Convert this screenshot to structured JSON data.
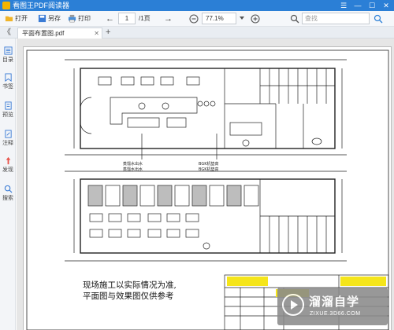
{
  "titlebar": {
    "app_title": "看图王PDF阅读器",
    "controls": [
      "☰",
      "—",
      "☐",
      "✕"
    ]
  },
  "toolbar": {
    "open_label": "打开",
    "saveas_label": "另存",
    "print_label": "打印",
    "prev_icon": "←",
    "page_current": "1",
    "page_total": "/1页",
    "next_icon": "→",
    "zoom_value": "77.1%",
    "search_placeholder": "查找"
  },
  "tabs": {
    "collapse_icon": "《",
    "items": [
      {
        "label": "平面布置图.pdf"
      }
    ],
    "add_icon": "+"
  },
  "sidebar": {
    "items": [
      {
        "label": "目录",
        "icon": "list-icon"
      },
      {
        "label": "书签",
        "icon": "bookmark-icon"
      },
      {
        "label": "预览",
        "icon": "preview-icon"
      },
      {
        "label": "注释",
        "icon": "note-icon"
      },
      {
        "label": "发现",
        "icon": "discover-icon"
      },
      {
        "label": "搜索",
        "icon": "search-icon"
      }
    ]
  },
  "drawing": {
    "upper_labels": [
      "蒸馏水出水",
      "BGK机垫高",
      "蒸馏水出水",
      "BGK机垫高"
    ],
    "note_lines": [
      "现场施工以实际情况为准,",
      "平面图与效果图仅供参考"
    ]
  },
  "watermark": {
    "brand": "溜溜自学",
    "url": "ZIXUE.3D66.COM"
  },
  "colors": {
    "titlebar": "#2b7fd6",
    "accent_yellow": "#f5e51a"
  }
}
